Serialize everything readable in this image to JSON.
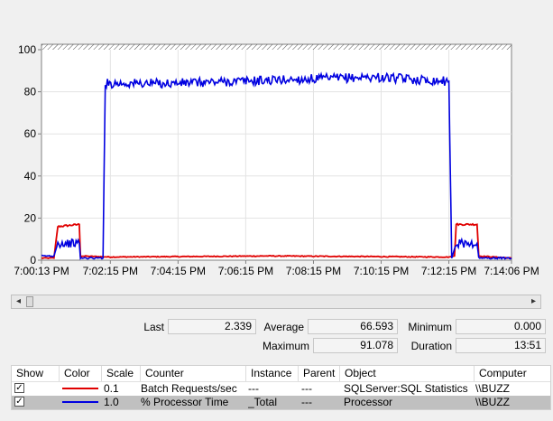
{
  "graph": {
    "y_ticks": [
      "100",
      "80",
      "60",
      "40",
      "20",
      "0"
    ],
    "x_ticks": [
      "7:00:13 PM",
      "7:02:15 PM",
      "7:04:15 PM",
      "7:06:15 PM",
      "7:08:15 PM",
      "7:10:15 PM",
      "7:12:15 PM",
      "7:14:06 PM"
    ]
  },
  "chart_data": {
    "type": "line",
    "ylim": [
      0,
      100
    ],
    "xlabel": "",
    "ylabel": "",
    "x_range": [
      "7:00:13 PM",
      "7:14:06 PM"
    ],
    "grid": true,
    "series": [
      {
        "name": "Batch Requests/sec",
        "color": "#e00000",
        "scale": "0.1",
        "points": [
          [
            "7:00:13 PM",
            1
          ],
          [
            "7:00:35 PM",
            1
          ],
          [
            "7:00:42 PM",
            16
          ],
          [
            "7:01:20 PM",
            17
          ],
          [
            "7:01:22 PM",
            2
          ],
          [
            "7:02:15 PM",
            1.5
          ],
          [
            "7:07:00 PM",
            2
          ],
          [
            "7:12:15 PM",
            1.5
          ],
          [
            "7:12:25 PM",
            2
          ],
          [
            "7:12:28 PM",
            17
          ],
          [
            "7:13:05 PM",
            17
          ],
          [
            "7:13:08 PM",
            2
          ],
          [
            "7:14:06 PM",
            1
          ]
        ]
      },
      {
        "name": "% Processor Time",
        "color": "#0000e0",
        "scale": "1.0",
        "points": [
          [
            "7:00:13 PM",
            2
          ],
          [
            "7:00:35 PM",
            2
          ],
          [
            "7:00:42 PM",
            8
          ],
          [
            "7:01:20 PM",
            8
          ],
          [
            "7:01:22 PM",
            1
          ],
          [
            "7:02:02 PM",
            1
          ],
          [
            "7:02:06 PM",
            84
          ],
          [
            "7:04:00 PM",
            84
          ],
          [
            "7:06:00 PM",
            85
          ],
          [
            "7:08:00 PM",
            86
          ],
          [
            "7:10:00 PM",
            87
          ],
          [
            "7:12:15 PM",
            85
          ],
          [
            "7:12:20 PM",
            1
          ],
          [
            "7:12:28 PM",
            8
          ],
          [
            "7:13:05 PM",
            8
          ],
          [
            "7:13:08 PM",
            1
          ],
          [
            "7:14:06 PM",
            1
          ]
        ]
      }
    ]
  },
  "stats": {
    "last_label": "Last",
    "last_value": "2.339",
    "average_label": "Average",
    "average_value": "66.593",
    "minimum_label": "Minimum",
    "minimum_value": "0.000",
    "maximum_label": "Maximum",
    "maximum_value": "91.078",
    "duration_label": "Duration",
    "duration_value": "13:51"
  },
  "legend_table": {
    "headers": {
      "show": "Show",
      "color": "Color",
      "scale": "Scale",
      "counter": "Counter",
      "instance": "Instance",
      "parent": "Parent",
      "object": "Object",
      "computer": "Computer"
    },
    "rows": [
      {
        "show": true,
        "color": "#e00000",
        "scale": "0.1",
        "counter": "Batch Requests/sec",
        "instance": "---",
        "parent": "---",
        "object": "SQLServer:SQL Statistics",
        "computer": "\\\\BUZZ"
      },
      {
        "show": true,
        "color": "#0000e0",
        "scale": "1.0",
        "counter": "% Processor Time",
        "instance": "_Total",
        "parent": "---",
        "object": "Processor",
        "computer": "\\\\BUZZ"
      }
    ]
  }
}
